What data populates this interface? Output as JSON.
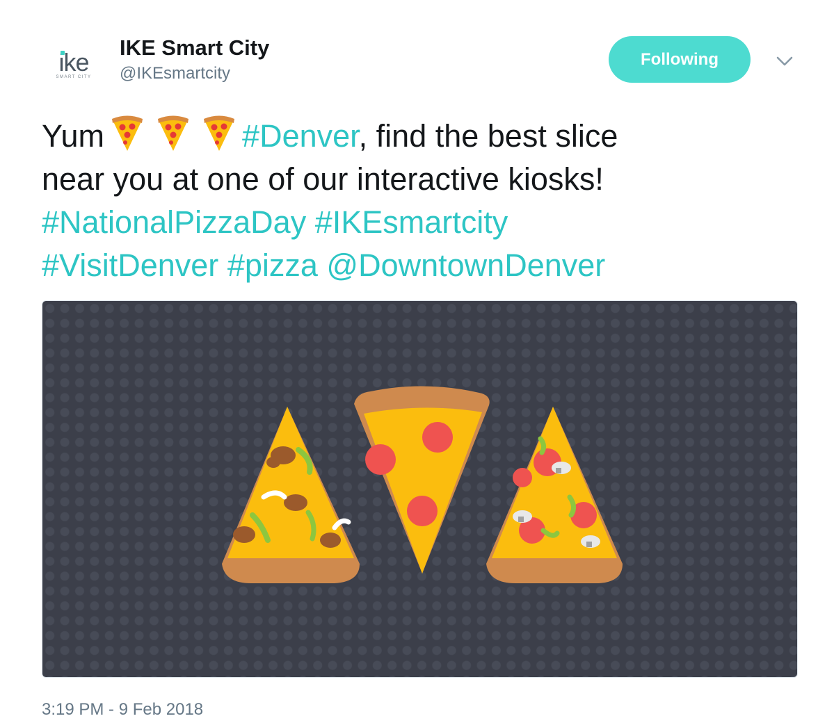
{
  "account": {
    "display_name": "IKE Smart City",
    "screen_name": "@IKEsmartcity",
    "avatar_wordmark": "ike",
    "avatar_subtext": "SMART CITY"
  },
  "follow_button": {
    "label": "Following",
    "color": "#4ddbd0"
  },
  "menu": {
    "icon": "chevron-down-icon"
  },
  "tweet": {
    "lines": [
      {
        "parts": [
          {
            "type": "text",
            "text": "Yum"
          },
          {
            "type": "emoji",
            "name": "pizza-emoji"
          },
          {
            "type": "emoji",
            "name": "pizza-emoji"
          },
          {
            "type": "emoji",
            "name": "pizza-emoji"
          },
          {
            "type": "hashtag",
            "text": "#Denver"
          },
          {
            "type": "text",
            "text": ", find the best slice"
          }
        ]
      },
      {
        "parts": [
          {
            "type": "text",
            "text": "near you at one of our interactive kiosks!"
          }
        ]
      },
      {
        "parts": [
          {
            "type": "hashtag",
            "text": "#NationalPizzaDay"
          },
          {
            "type": "text",
            "text": " "
          },
          {
            "type": "hashtag",
            "text": "#IKEsmartcity"
          }
        ]
      },
      {
        "parts": [
          {
            "type": "hashtag",
            "text": "#VisitDenver"
          },
          {
            "type": "text",
            "text": " "
          },
          {
            "type": "hashtag",
            "text": "#pizza"
          },
          {
            "type": "text",
            "text": " "
          },
          {
            "type": "mention",
            "text": "@DowntownDenver"
          }
        ]
      }
    ],
    "link_color": "#2dc5c4"
  },
  "media": {
    "background_color": "#3c3f4a",
    "slices": [
      "sausage-pepper-slice",
      "pepperoni-slice",
      "pepperoni-mushroom-slice"
    ]
  },
  "timestamp": "3:19 PM - 9 Feb 2018"
}
